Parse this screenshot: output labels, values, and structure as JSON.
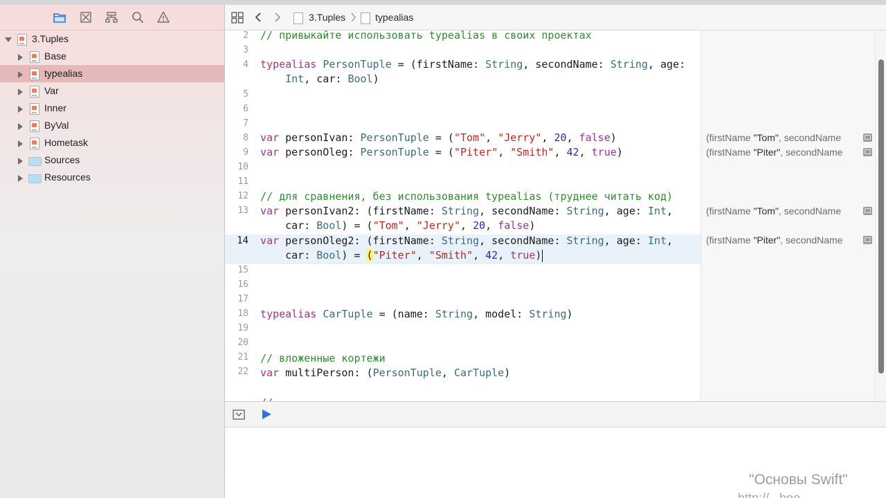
{
  "navigator": {
    "toolbar_icons": [
      "folder-icon",
      "source-control-icon",
      "hierarchy-icon",
      "search-icon",
      "warning-icon"
    ],
    "items": [
      {
        "label": "3.Tuples",
        "kind": "playground",
        "expanded": true
      },
      {
        "label": "Base",
        "kind": "page"
      },
      {
        "label": "typealias",
        "kind": "page",
        "selected": true
      },
      {
        "label": "Var",
        "kind": "page"
      },
      {
        "label": "Inner",
        "kind": "page"
      },
      {
        "label": "ByVal",
        "kind": "page"
      },
      {
        "label": "Hometask",
        "kind": "page"
      },
      {
        "label": "Sources",
        "kind": "folder"
      },
      {
        "label": "Resources",
        "kind": "folder"
      }
    ]
  },
  "jumpbar": {
    "crumb_project": "3.Tuples",
    "crumb_file": "typealias"
  },
  "code": {
    "current_line": "14",
    "lines": [
      {
        "num": "2",
        "text": "// привыкайте использовать typealias в своих проектах"
      },
      {
        "num": "3",
        "text": ""
      },
      {
        "num": "4",
        "text": "typealias PersonTuple = (firstName: String, secondName: String, age:"
      },
      {
        "num": "",
        "text": "    Int, car: Bool)"
      },
      {
        "num": "5",
        "text": ""
      },
      {
        "num": "6",
        "text": ""
      },
      {
        "num": "7",
        "text": ""
      },
      {
        "num": "8",
        "text": "var personIvan: PersonTuple = (\"Tom\", \"Jerry\", 20, false)"
      },
      {
        "num": "9",
        "text": "var personOleg: PersonTuple = (\"Piter\", \"Smith\", 42, true)"
      },
      {
        "num": "10",
        "text": ""
      },
      {
        "num": "11",
        "text": ""
      },
      {
        "num": "12",
        "text": "// для сравнения, без использования typealias (труднее читать код)"
      },
      {
        "num": "13",
        "text": "var personIvan2: (firstName: String, secondName: String, age: Int,"
      },
      {
        "num": "",
        "text": "    car: Bool) = (\"Tom\", \"Jerry\", 20, false)"
      },
      {
        "num": "14",
        "text": "var personOleg2: (firstName: String, secondName: String, age: Int,"
      },
      {
        "num": "",
        "text": "    car: Bool) = (\"Piter\", \"Smith\", 42, true)"
      },
      {
        "num": "15",
        "text": ""
      },
      {
        "num": "16",
        "text": ""
      },
      {
        "num": "17",
        "text": ""
      },
      {
        "num": "18",
        "text": "typealias CarTuple = (name: String, model: String)"
      },
      {
        "num": "19",
        "text": ""
      },
      {
        "num": "20",
        "text": ""
      },
      {
        "num": "21",
        "text": "// вложенные кортежи"
      },
      {
        "num": "22",
        "text": "var multiPerson: (PersonTuple, CarTuple)"
      }
    ]
  },
  "results": [
    {
      "k1": "(firstName ",
      "v1": "\"Tom\"",
      "k2": ", secondName"
    },
    {
      "k1": "(firstName ",
      "v1": "\"Piter\"",
      "k2": ", secondName"
    },
    {
      "k1": "(firstName ",
      "v1": "\"Tom\"",
      "k2": ", secondName"
    },
    {
      "k1": "(firstName ",
      "v1": "\"Piter\"",
      "k2": ", secondName"
    }
  ],
  "colors": {
    "comment": "#2f8c2f",
    "keyword": "#a2338b",
    "type": "#3a6c80",
    "string": "#c4251a",
    "number": "#2b2aa8",
    "selected_row": "#e5b9b9",
    "current_line": "#e9f1fb",
    "run_button": "#2f74d8"
  },
  "watermark": {
    "line1": "\"Основы Swift\"",
    "line2": "http://...boo..."
  }
}
